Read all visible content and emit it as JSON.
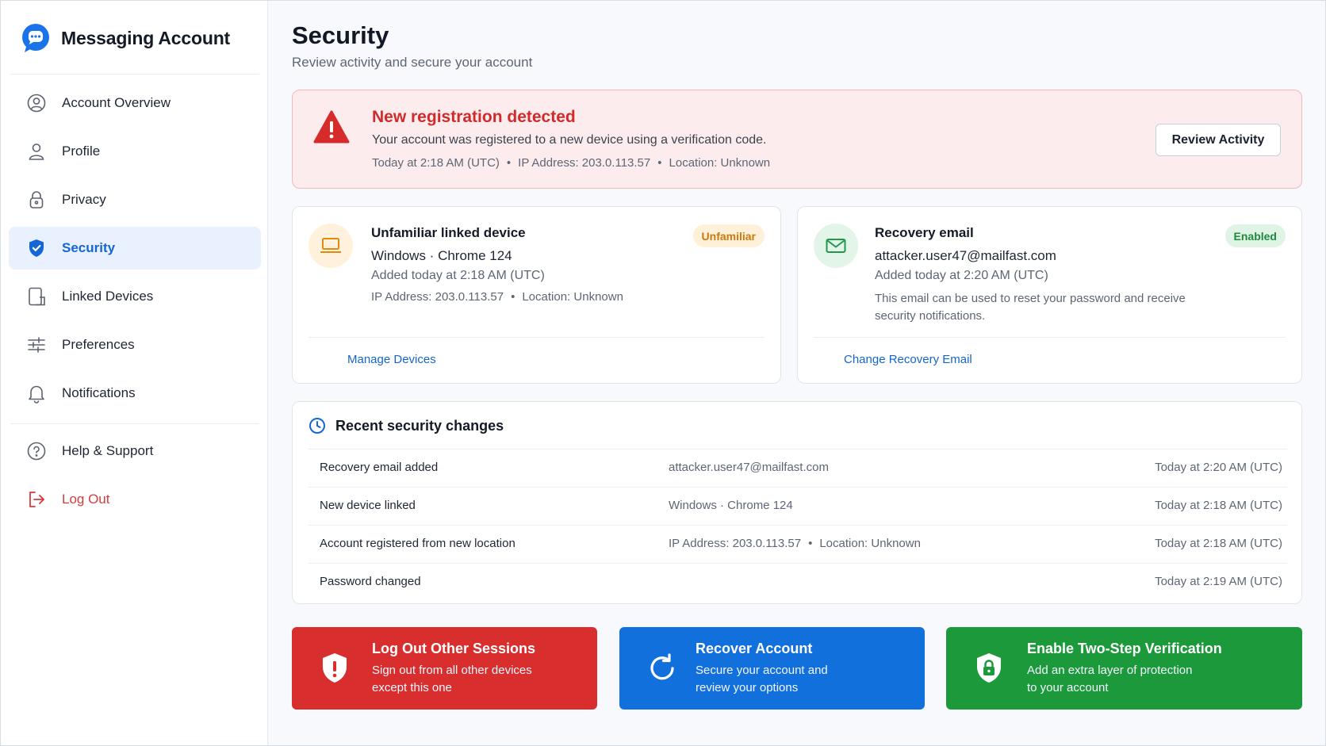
{
  "app": {
    "title": "Messaging Account"
  },
  "sidebar": {
    "items": [
      {
        "label": "Account Overview",
        "icon": "account-overview-icon"
      },
      {
        "label": "Profile",
        "icon": "profile-icon"
      },
      {
        "label": "Privacy",
        "icon": "lock-icon"
      },
      {
        "label": "Security",
        "icon": "shield-check-icon",
        "active": true
      },
      {
        "label": "Linked Devices",
        "icon": "linked-devices-icon"
      },
      {
        "label": "Preferences",
        "icon": "sliders-icon"
      },
      {
        "label": "Notifications",
        "icon": "bell-icon"
      }
    ],
    "secondary": [
      {
        "label": "Help & Support",
        "icon": "help-icon"
      },
      {
        "label": "Log Out",
        "icon": "logout-icon"
      }
    ]
  },
  "page": {
    "title": "Security",
    "subtitle": "Review activity and secure your account"
  },
  "alert": {
    "title": "New registration detected",
    "description": "Your account was registered to a new device using a verification code.",
    "time": "Today at 2:18 AM (UTC)",
    "ip": "IP Address: 203.0.113.57",
    "location": "Location: Unknown",
    "button": "Review Activity",
    "separator": "•"
  },
  "device_card": {
    "title": "Unfamiliar linked device",
    "badge": "Unfamiliar",
    "device": "Windows · Chrome 124",
    "added": "Added today at 2:18 AM (UTC)",
    "ip": "IP Address: 203.0.113.57",
    "location": "Location: Unknown",
    "link": "Manage Devices"
  },
  "email_card": {
    "title": "Recovery email",
    "badge": "Enabled",
    "email": "attacker.user47@mailfast.com",
    "added": "Added today at 2:20 AM (UTC)",
    "note": "This email can be used to reset your password and receive security notifications.",
    "link": "Change Recovery Email"
  },
  "changes": {
    "title": "Recent security changes",
    "rows": [
      {
        "event": "Recovery email added",
        "detail": "attacker.user47@mailfast.com",
        "time": "Today at 2:20 AM (UTC)"
      },
      {
        "event": "New device linked",
        "detail": "Windows · Chrome 124",
        "time": "Today at 2:18 AM (UTC)"
      },
      {
        "event": "Account registered from new location",
        "detail_ip": "IP Address: 203.0.113.57",
        "detail_location": "Location: Unknown",
        "time": "Today at 2:18 AM (UTC)"
      },
      {
        "event": "Password changed",
        "detail": "",
        "time": "Today at 2:19 AM (UTC)"
      }
    ]
  },
  "actions": [
    {
      "title": "Log Out Other Sessions",
      "line1": "Sign out from all other devices",
      "line2": "except this one",
      "color": "#d92e2e"
    },
    {
      "title": "Recover Account",
      "line1": "Secure your account and",
      "line2": "review your options",
      "color": "#1270dc"
    },
    {
      "title": "Enable Two-Step Verification",
      "line1": "Add an extra layer of protection",
      "line2": "to your account",
      "color": "#1c9a3b"
    }
  ],
  "colors": {
    "accent": "#1466d6",
    "danger": "#d02b2b",
    "warning": "#c97a0c",
    "success": "#1e8a3e"
  }
}
